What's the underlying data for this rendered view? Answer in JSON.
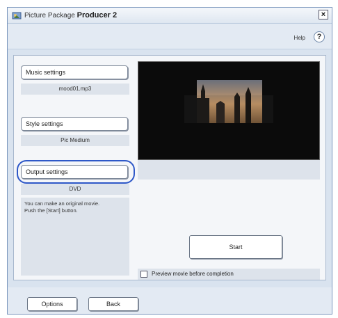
{
  "window": {
    "title_prefix": "Picture Package",
    "title_bold": "Producer 2",
    "close_glyph": "×"
  },
  "toolbar": {
    "help_label": "Help",
    "help_icon_glyph": "?"
  },
  "settings": {
    "music": {
      "button_label": "Music settings",
      "value": "mood01.mp3"
    },
    "style": {
      "button_label": "Style settings",
      "value": "Pic Medium"
    },
    "output": {
      "button_label": "Output settings",
      "value": "DVD"
    }
  },
  "info": {
    "lines": [
      "You can make an original movie.",
      "Push the [Start] button."
    ]
  },
  "preview": {
    "start_label": "Start",
    "checkbox_label": "Preview movie before completion",
    "checkbox_checked": false
  },
  "footer": {
    "options_label": "Options",
    "back_label": "Back"
  },
  "colors": {
    "window_bg": "#d9e3ef",
    "focus_ring": "#2e58c8",
    "preview_bg": "#0b0b0b"
  }
}
